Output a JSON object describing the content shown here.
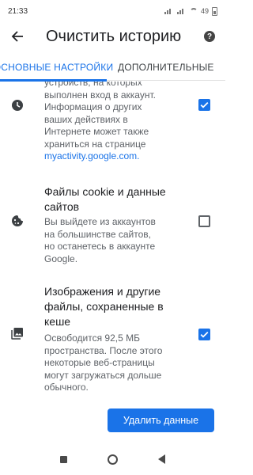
{
  "status_bar": {
    "time": "21:33",
    "battery": "49"
  },
  "header": {
    "title": "Очистить историю"
  },
  "tabs": [
    {
      "label": "ОСНОВНЫЕ НАСТРОЙКИ",
      "active": true
    },
    {
      "label": "ДОПОЛНИТЕЛЬНЫЕ",
      "active": false
    }
  ],
  "items": [
    {
      "icon": "history-clock-icon",
      "desc_lines": [
        "устройств, на которых",
        "выполнен вход в аккаунт.",
        "Информация о других",
        "ваших действиях в",
        "Интернете может также",
        "храниться на странице"
      ],
      "link": "myactivity.google.com.",
      "checked": true
    },
    {
      "icon": "cookie-icon",
      "title_lines": [
        "Файлы cookie и данные",
        "сайтов"
      ],
      "desc_lines": [
        "Вы выйдете из аккаунтов",
        "на большинстве сайтов,",
        "но останетесь в аккаунте",
        "Google."
      ],
      "checked": false
    },
    {
      "icon": "image-icon",
      "title_lines": [
        "Изображения и другие",
        "файлы, сохраненные в",
        "кеше"
      ],
      "desc_lines": [
        "Освободится 92,5 МБ",
        "пространства. После этого",
        "некоторые веб-страницы",
        "могут загружаться дольше",
        "обычного."
      ],
      "checked": true
    }
  ],
  "actions": {
    "delete_label": "Удалить данные"
  },
  "colors": {
    "accent": "#1a73e8",
    "text_primary": "#202124",
    "text_secondary": "#5f6368"
  }
}
